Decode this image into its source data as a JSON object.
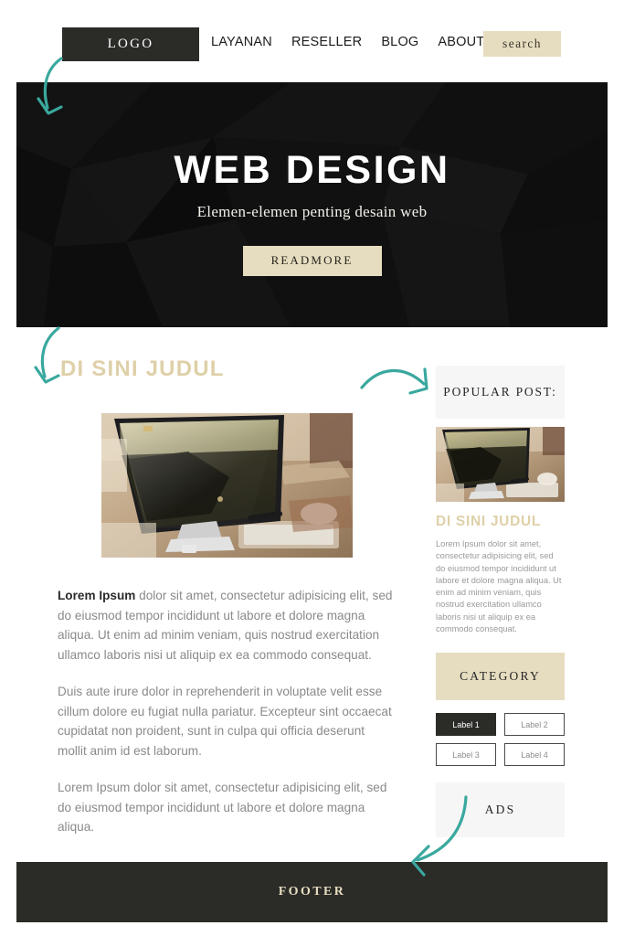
{
  "header": {
    "logo": "LOGO",
    "nav": [
      {
        "label": "LAYANAN"
      },
      {
        "label": "RESELLER"
      },
      {
        "label": "BLOG"
      },
      {
        "label": "ABOUT US"
      }
    ],
    "search": "search"
  },
  "hero": {
    "title": "WEB DESIGN",
    "subtitle": "Elemen-elemen penting desain web",
    "cta": "READMORE"
  },
  "article": {
    "heading": "DI SINI JUDUL",
    "image_alt": "desk-with-monitor-photo",
    "paragraphs": [
      {
        "lead": "Lorem Ipsum",
        "text": " dolor sit amet, consectetur adipisicing elit, sed do eiusmod tempor incididunt ut labore et dolore magna aliqua. Ut enim ad minim veniam, quis nostrud exercitation ullamco laboris nisi ut aliquip ex ea commodo consequat."
      },
      {
        "lead": "",
        "text": "Duis aute irure dolor in reprehenderit in voluptate velit esse cillum dolore eu fugiat nulla pariatur. Excepteur sint occaecat cupidatat non proident, sunt in culpa qui officia deserunt mollit anim id est laborum."
      },
      {
        "lead": "",
        "text": "Lorem Ipsum dolor sit amet, consectetur adipisicing elit, sed do eiusmod tempor incididunt ut labore et dolore magna aliqua."
      }
    ]
  },
  "sidebar": {
    "popular_post_title": "POPULAR POST:",
    "popular_post_image_alt": "desk-with-monitor-thumbnail",
    "popular_post_heading": "DI SINI JUDUL",
    "popular_post_text": "Lorem Ipsum dolor sit amet, consectetur adipisicing elit, sed do eiusmod tempor incididunt ut labore et dolore magna aliqua. Ut enim ad minim veniam, quis nostrud exercitation ullamco laboris nisi ut aliquip ex ea commodo consequat.",
    "category_title": "CATEGORY",
    "labels": [
      {
        "label": "Label 1",
        "style": "filled"
      },
      {
        "label": "Label 2",
        "style": "outline"
      },
      {
        "label": "Label 3",
        "style": "outline"
      },
      {
        "label": "Label 4",
        "style": "outline"
      }
    ],
    "ads_title": "ADS"
  },
  "footer": {
    "label": "FOOTER"
  },
  "annotations": {
    "arrow_color": "#3aa89e",
    "arrows": [
      {
        "name": "arrow-to-hero",
        "target": "hero-banner"
      },
      {
        "name": "arrow-to-article-heading",
        "target": "article-heading"
      },
      {
        "name": "arrow-to-popular-post",
        "target": "popular-post-box"
      },
      {
        "name": "arrow-to-footer",
        "target": "footer-bar"
      }
    ]
  },
  "colors": {
    "accent_tan": "#e6ddc0",
    "heading_tan": "#ded0a8",
    "dark": "#2b2b28",
    "hero_dark": "#0c0c0c",
    "body_gray": "#8a8a8a",
    "panel_gray": "#f6f6f6",
    "arrow_teal": "#3aa89e"
  }
}
